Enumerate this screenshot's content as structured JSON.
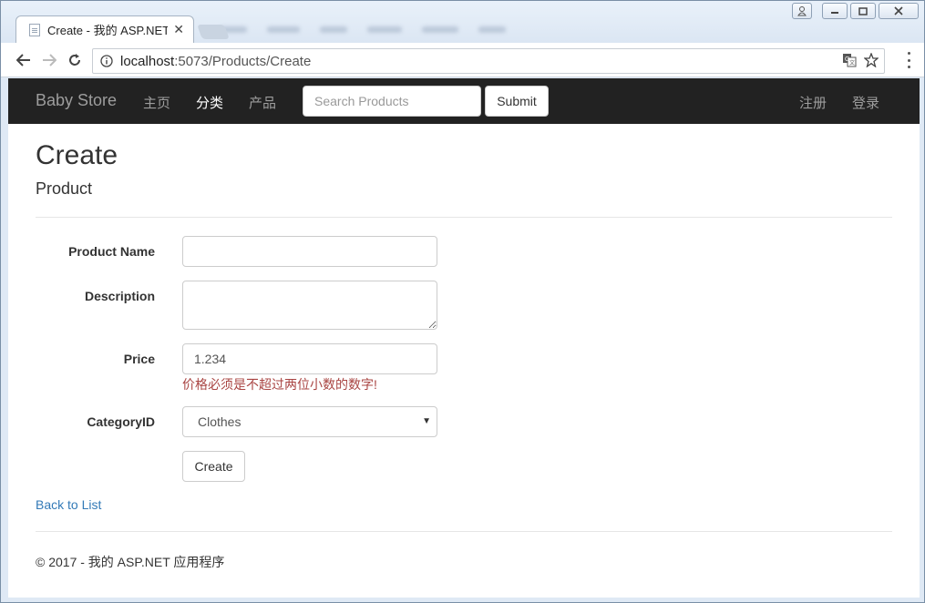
{
  "browser": {
    "tab_title": "Create - 我的 ASP.NET",
    "url_host": "localhost",
    "url_path": ":5073/Products/Create"
  },
  "navbar": {
    "brand": "Baby Store",
    "links": [
      "主页",
      "分类",
      "产品"
    ],
    "active_link": "分类",
    "search_placeholder": "Search Products",
    "submit_label": "Submit",
    "right_links": [
      "注册",
      "登录"
    ]
  },
  "page": {
    "title": "Create",
    "subtitle": "Product"
  },
  "form": {
    "product_name": {
      "label": "Product Name",
      "value": ""
    },
    "description": {
      "label": "Description",
      "value": ""
    },
    "price": {
      "label": "Price",
      "value": "1.234",
      "error": "价格必须是不超过两位小数的数字!"
    },
    "category": {
      "label": "CategoryID",
      "selected": "Clothes"
    },
    "create_label": "Create"
  },
  "back_link": "Back to List",
  "footer": "© 2017 - 我的 ASP.NET 应用程序",
  "colors": {
    "navbar_bg": "#222222",
    "nav_text": "#9d9d9d",
    "link": "#337ab7",
    "error": "#a94442"
  }
}
